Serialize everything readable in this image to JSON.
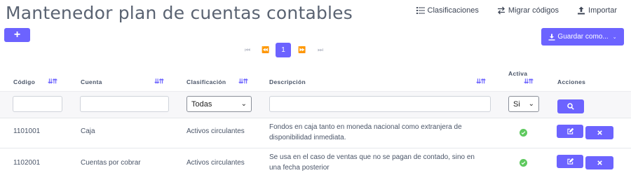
{
  "header": {
    "title": "Mantenedor plan de cuentas contables",
    "actions": [
      {
        "label": "Clasificaciones",
        "icon": "list-icon"
      },
      {
        "label": "Migrar códigos",
        "icon": "swap-icon"
      },
      {
        "label": "Importar",
        "icon": "upload-icon"
      }
    ]
  },
  "toolbar": {
    "add_label": "+",
    "save_label": "Guardar como..."
  },
  "pagination": {
    "current_page": "1",
    "first": "⏮",
    "prev": "⏪",
    "next": "⏩",
    "last": "⏭"
  },
  "table": {
    "columns": {
      "codigo": "Código",
      "cuenta": "Cuenta",
      "clasificacion": "Clasificación",
      "descripcion": "Descripción",
      "activa": "Activa",
      "acciones": "Acciones"
    },
    "sort_label": "⇊⇈",
    "filters": {
      "clasificacion_selected": "Todas",
      "activa_selected": "Si"
    },
    "rows": [
      {
        "codigo": "1101001",
        "cuenta": "Caja",
        "clasificacion": "Activos circulantes",
        "descripcion": "Fondos en caja tanto en moneda nacional como extranjera de disponibilidad inmediata.",
        "activa": true
      },
      {
        "codigo": "1102001",
        "cuenta": "Cuentas por cobrar",
        "clasificacion": "Activos circulantes",
        "descripcion": "Se usa en el caso de ventas que no se pagan de contado, sino en una fecha posterior",
        "activa": true
      }
    ]
  },
  "colors": {
    "accent": "#6c63ff",
    "active_check": "#5ec95e"
  }
}
